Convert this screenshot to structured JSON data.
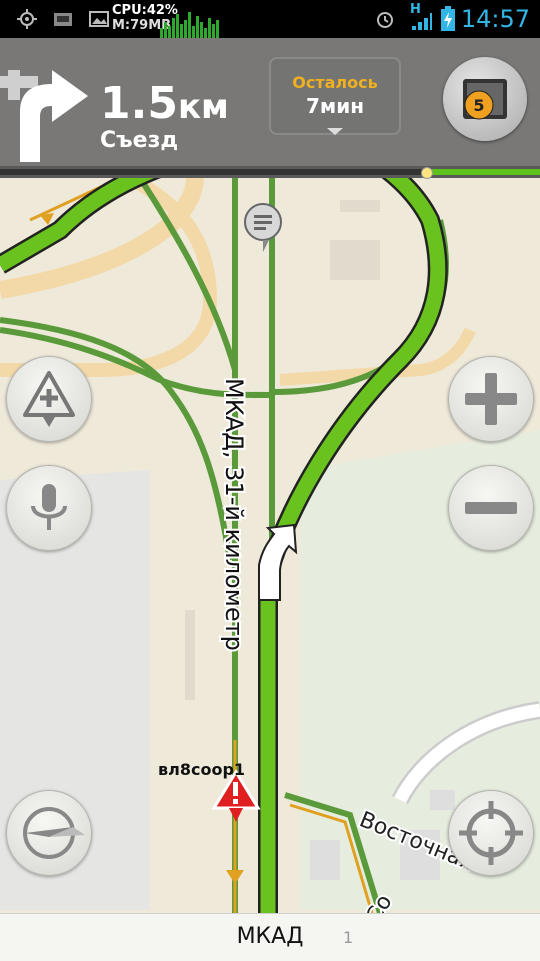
{
  "status_bar": {
    "cpu": "CPU:42%",
    "mem": "M:79MB",
    "network": "H",
    "time": "14:57"
  },
  "maneuver": {
    "distance_value": "1.5",
    "distance_unit": "км",
    "action": "Съезд",
    "icon": "turn-right-arrow-icon"
  },
  "remaining": {
    "label": "Осталось",
    "value": "7мин"
  },
  "traffic": {
    "score": "5"
  },
  "route_progress": 0.79,
  "map": {
    "road_label": "МКАД, 31-й километр",
    "street_label": "Восточная",
    "street_label_2": "Со",
    "poi_label": "вл8coop1",
    "route_color": "#6ac21e",
    "road_color": "#5a9a3a"
  },
  "bottom_bar": {
    "street": "МКАД",
    "house": "1"
  },
  "controls": {
    "add_incident": "incident-add-icon",
    "voice": "microphone-icon",
    "zoom_in": "plus-icon",
    "zoom_out": "minus-icon",
    "compass": "compass-icon",
    "locate": "locate-icon"
  }
}
